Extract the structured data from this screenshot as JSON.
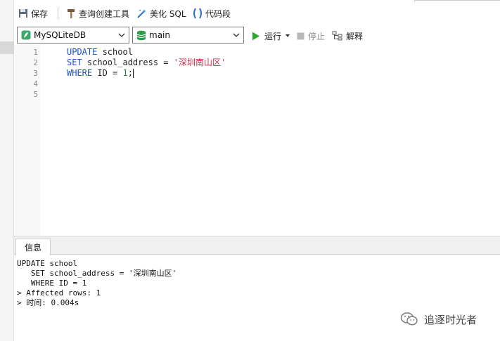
{
  "toolbar": {
    "save_label": "保存",
    "query_builder_label": "查询创建工具",
    "beautify_label": "美化 SQL",
    "snippet_label": "代码段"
  },
  "connection": {
    "selected": "MySQLiteDB"
  },
  "database": {
    "selected": "main"
  },
  "actions": {
    "run_label": "运行",
    "stop_label": "停止",
    "explain_label": "解释"
  },
  "editor": {
    "line_numbers": [
      "1",
      "2",
      "3",
      "4",
      "5"
    ],
    "line1": {
      "kw": "UPDATE",
      "rest": " school"
    },
    "line2": {
      "kw": "SET",
      "mid": " school_address = ",
      "str": "'深圳南山区'"
    },
    "line3": {
      "kw": "WHERE",
      "mid": " ID = ",
      "num": "1",
      "end": ";"
    }
  },
  "result": {
    "tab_label": "信息",
    "lines": [
      "UPDATE school",
      "   SET school_address = '深圳南山区'",
      "   WHERE ID = 1",
      "> Affected rows: 1",
      "> 时间: 0.004s"
    ]
  },
  "watermark": {
    "text": "追逐时光者"
  },
  "colors": {
    "keyword": "#1a4fd1",
    "string": "#d62a4a",
    "number": "#1c8a3a",
    "run_green": "#2fa82f"
  }
}
